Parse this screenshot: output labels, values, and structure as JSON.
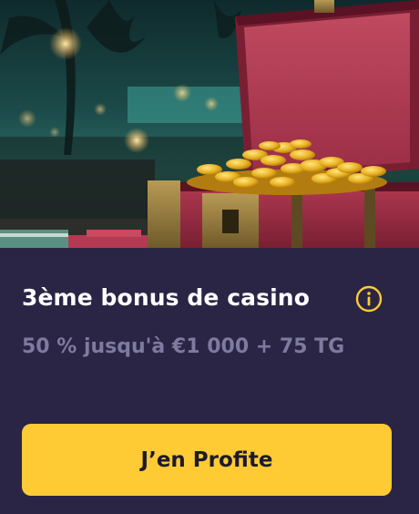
{
  "bonus": {
    "title": "3ème bonus de casino",
    "offer": "50 % jusqu'à €1 000 + 75 TG",
    "cta_label": "J’en Profite"
  },
  "hero": {
    "image": "treasure-chest-gold-coins-illustration"
  },
  "icons": {
    "info": "info-circle-icon"
  },
  "colors": {
    "card_background": "#2a2545",
    "title_text": "#ffffff",
    "offer_text": "#7f7a9f",
    "cta_background": "#fecb34",
    "cta_text": "#1d1a2e",
    "info_icon": "#fecb34"
  }
}
